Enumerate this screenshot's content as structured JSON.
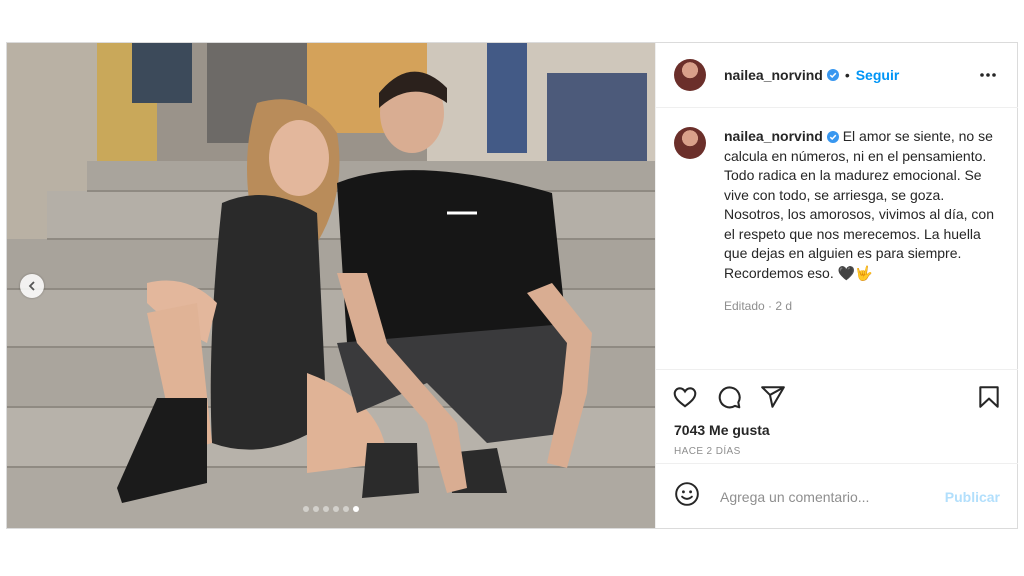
{
  "post": {
    "username": "nailea_norvind",
    "separator": "•",
    "follow_label": "Seguir",
    "caption": "El amor se siente, no se calcula en números, ni en el pensamiento. Todo radica en la madurez emocional. Se vive con todo, se arriesga, se goza. Nosotros, los amorosos, vivimos al día, con el respeto que nos merecemos. La huella que dejas en alguien es para siempre. Recordemos eso. 🖤🤟",
    "edited": "Editado · 2 d",
    "likes": "7043 Me gusta",
    "time_ago": "HACE 2 DÍAS",
    "comment_placeholder": "Agrega un comentario...",
    "publish_label": "Publicar",
    "carousel": {
      "total": 6,
      "active": 6
    }
  },
  "icons": {
    "verified": "verified-badge-icon",
    "more": "more-options-icon",
    "like": "heart-icon",
    "comment": "comment-icon",
    "share": "paper-plane-icon",
    "save": "bookmark-icon",
    "emoji": "smiley-icon",
    "prev": "chevron-left-icon"
  },
  "colors": {
    "follow": "#0095f6",
    "publish_disabled": "#b2dffc",
    "verified": "#3897f0"
  }
}
